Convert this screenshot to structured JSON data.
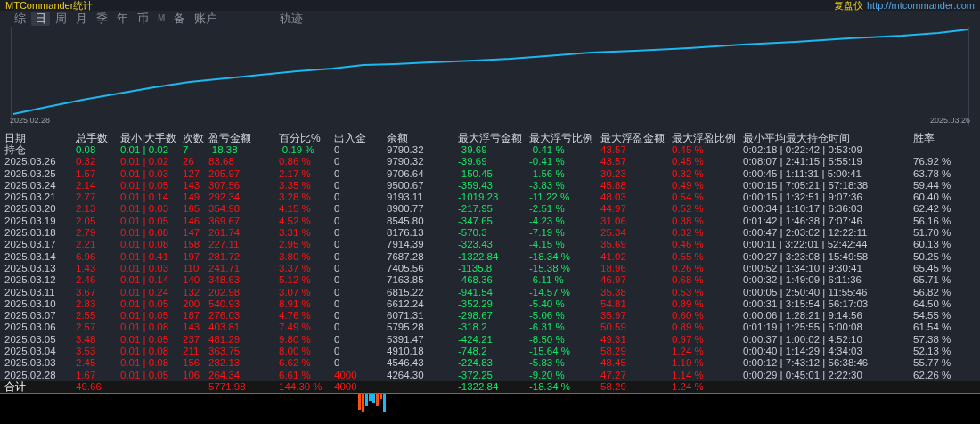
{
  "header": {
    "title": "MTCommander统计",
    "right_label": "复盘仪",
    "url": "http://mtcommander.com"
  },
  "tabs": [
    {
      "label": "综",
      "selected": false,
      "disabled": false
    },
    {
      "label": "日",
      "selected": true,
      "disabled": false
    },
    {
      "label": "周",
      "selected": false,
      "disabled": false
    },
    {
      "label": "月",
      "selected": false,
      "disabled": false
    },
    {
      "label": "季",
      "selected": false,
      "disabled": false
    },
    {
      "label": "年",
      "selected": false,
      "disabled": false
    },
    {
      "label": "币",
      "selected": false,
      "disabled": false
    },
    {
      "label": "M",
      "selected": false,
      "disabled": true
    },
    {
      "label": "备",
      "selected": false,
      "disabled": false
    },
    {
      "label": "账户",
      "selected": false,
      "disabled": false
    }
  ],
  "trace_tab": {
    "label": "轨迹",
    "selected": false
  },
  "equity_chart": {
    "start_label": "2025.02.28",
    "end_label": "2025.03.26"
  },
  "table": {
    "columns": [
      "日期",
      "总手数",
      "最小|大手数",
      "次数",
      "盈亏金额",
      "百分比%",
      "出入金",
      "余额",
      "最大浮亏金额",
      "最大浮亏比例",
      "最大浮盈金额",
      "最大浮盈比例",
      "最小平均最大持仓时间",
      "胜率"
    ],
    "rows": [
      {
        "kind": "open",
        "date": "持仓",
        "lots": "0.08",
        "lot_range": "0.01 | 0.02",
        "trades": "7",
        "pnl": "-18.38",
        "pct": "-0.19 %",
        "deposit": "0",
        "deposit_highlighted": false,
        "balance": "9790.32",
        "max_loss": "-39.69",
        "max_loss_pct": "-0.41 %",
        "max_profit": "43.57",
        "max_profit_pct": "0.45 %",
        "hold_time": "0:02:18 | 0:22:42 | 0:53:09"
      },
      {
        "kind": "day",
        "date": "2025.03.26",
        "lots": "0.32",
        "lot_range": "0.01 | 0.02",
        "trades": "26",
        "pnl": "83.68",
        "pct": "0.86 %",
        "deposit": "0",
        "deposit_highlighted": false,
        "balance": "9790.32",
        "max_loss": "-39.69",
        "max_loss_pct": "-0.41 %",
        "max_profit": "43.57",
        "max_profit_pct": "0.45 %",
        "hold_time": "0:08:07 | 2:41:15 | 5:55:19",
        "win_rate": "76.92 %"
      },
      {
        "kind": "day",
        "date": "2025.03.25",
        "lots": "1.57",
        "lot_range": "0.01 | 0.03",
        "trades": "127",
        "pnl": "205.97",
        "pct": "2.17 %",
        "deposit": "0",
        "deposit_highlighted": false,
        "balance": "9706.64",
        "max_loss": "-150.45",
        "max_loss_pct": "-1.56 %",
        "max_profit": "30.23",
        "max_profit_pct": "0.32 %",
        "hold_time": "0:00:45 | 1:11:31 | 5:00:41",
        "win_rate": "63.78 %"
      },
      {
        "kind": "day",
        "date": "2025.03.24",
        "lots": "2.14",
        "lot_range": "0.01 | 0.05",
        "trades": "143",
        "pnl": "307.56",
        "pct": "3.35 %",
        "deposit": "0",
        "deposit_highlighted": false,
        "balance": "9500.67",
        "max_loss": "-359.43",
        "max_loss_pct": "-3.83 %",
        "max_profit": "45.88",
        "max_profit_pct": "0.49 %",
        "hold_time": "0:00:15 | 7:05:21 | 57:18:38",
        "win_rate": "59.44 %"
      },
      {
        "kind": "day",
        "date": "2025.03.21",
        "lots": "2.77",
        "lot_range": "0.01 | 0.14",
        "trades": "149",
        "pnl": "292.34",
        "pct": "3.28 %",
        "deposit": "0",
        "deposit_highlighted": false,
        "balance": "9193.11",
        "max_loss": "-1019.23",
        "max_loss_pct": "-11.22 %",
        "max_profit": "48.03",
        "max_profit_pct": "0.54 %",
        "hold_time": "0:00:15 | 1:32:51 | 9:07:36",
        "win_rate": "60.40 %"
      },
      {
        "kind": "day",
        "date": "2025.03.20",
        "lots": "2.13",
        "lot_range": "0.01 | 0.03",
        "trades": "165",
        "pnl": "354.98",
        "pct": "4.15 %",
        "deposit": "0",
        "deposit_highlighted": false,
        "balance": "8900.77",
        "max_loss": "-217.95",
        "max_loss_pct": "-2.51 %",
        "max_profit": "44.97",
        "max_profit_pct": "0.52 %",
        "hold_time": "0:00:34 | 1:10:17 | 6:36:03",
        "win_rate": "62.42 %"
      },
      {
        "kind": "day",
        "date": "2025.03.19",
        "lots": "2.05",
        "lot_range": "0.01 | 0.05",
        "trades": "146",
        "pnl": "369.67",
        "pct": "4.52 %",
        "deposit": "0",
        "deposit_highlighted": false,
        "balance": "8545.80",
        "max_loss": "-347.65",
        "max_loss_pct": "-4.23 %",
        "max_profit": "31.06",
        "max_profit_pct": "0.38 %",
        "hold_time": "0:01:42 | 1:46:38 | 7:07:46",
        "win_rate": "56.16 %"
      },
      {
        "kind": "day",
        "date": "2025.03.18",
        "lots": "2.79",
        "lot_range": "0.01 | 0.08",
        "trades": "147",
        "pnl": "261.74",
        "pct": "3.31 %",
        "deposit": "0",
        "deposit_highlighted": false,
        "balance": "8176.13",
        "max_loss": "-570.3",
        "max_loss_pct": "-7.19 %",
        "max_profit": "25.34",
        "max_profit_pct": "0.32 %",
        "hold_time": "0:00:47 | 2:03:02 | 12:22:11",
        "win_rate": "51.70 %"
      },
      {
        "kind": "day",
        "date": "2025.03.17",
        "lots": "2.21",
        "lot_range": "0.01 | 0.08",
        "trades": "158",
        "pnl": "227.11",
        "pct": "2.95 %",
        "deposit": "0",
        "deposit_highlighted": false,
        "balance": "7914.39",
        "max_loss": "-323.43",
        "max_loss_pct": "-4.15 %",
        "max_profit": "35.69",
        "max_profit_pct": "0.46 %",
        "hold_time": "0:00:11 | 3:22:01 | 52:42:44",
        "win_rate": "60.13 %"
      },
      {
        "kind": "day",
        "date": "2025.03.14",
        "lots": "6.96",
        "lot_range": "0.01 | 0.41",
        "trades": "197",
        "pnl": "281.72",
        "pct": "3.80 %",
        "deposit": "0",
        "deposit_highlighted": false,
        "balance": "7687.28",
        "max_loss": "-1322.84",
        "max_loss_pct": "-18.34 %",
        "max_profit": "41.02",
        "max_profit_pct": "0.55 %",
        "hold_time": "0:00:27 | 3:23:08 | 15:49:58",
        "win_rate": "50.25 %"
      },
      {
        "kind": "day",
        "date": "2025.03.13",
        "lots": "1.43",
        "lot_range": "0.01 | 0.03",
        "trades": "110",
        "pnl": "241.71",
        "pct": "3.37 %",
        "deposit": "0",
        "deposit_highlighted": false,
        "balance": "7405.56",
        "max_loss": "-1135.8",
        "max_loss_pct": "-15.38 %",
        "max_profit": "18.96",
        "max_profit_pct": "0.26 %",
        "hold_time": "0:00:52 | 1:34:10 | 9:30:41",
        "win_rate": "65.45 %"
      },
      {
        "kind": "day",
        "date": "2025.03.12",
        "lots": "2.46",
        "lot_range": "0.01 | 0.14",
        "trades": "140",
        "pnl": "348.63",
        "pct": "5.12 %",
        "deposit": "0",
        "deposit_highlighted": false,
        "balance": "7163.85",
        "max_loss": "-468.36",
        "max_loss_pct": "-6.11 %",
        "max_profit": "46.97",
        "max_profit_pct": "0.68 %",
        "hold_time": "0:00:32 | 1:49:09 | 6:11:36",
        "win_rate": "65.71 %"
      },
      {
        "kind": "day",
        "date": "2025.03.11",
        "lots": "3.67",
        "lot_range": "0.01 | 0.24",
        "trades": "132",
        "pnl": "202.98",
        "pct": "3.07 %",
        "deposit": "0",
        "deposit_highlighted": false,
        "balance": "6815.22",
        "max_loss": "-941.54",
        "max_loss_pct": "-14.57 %",
        "max_profit": "35.38",
        "max_profit_pct": "0.53 %",
        "hold_time": "0:00:05 | 2:50:40 | 11:55:46",
        "win_rate": "56.82 %"
      },
      {
        "kind": "day",
        "date": "2025.03.10",
        "lots": "2.83",
        "lot_range": "0.01 | 0.05",
        "trades": "200",
        "pnl": "540.93",
        "pct": "8.91 %",
        "deposit": "0",
        "deposit_highlighted": false,
        "balance": "6612.24",
        "max_loss": "-352.29",
        "max_loss_pct": "-5.40 %",
        "max_profit": "54.81",
        "max_profit_pct": "0.89 %",
        "hold_time": "0:00:31 | 3:15:54 | 56:17:03",
        "win_rate": "64.50 %"
      },
      {
        "kind": "day",
        "date": "2025.03.07",
        "lots": "2.55",
        "lot_range": "0.01 | 0.05",
        "trades": "187",
        "pnl": "276.03",
        "pct": "4.76 %",
        "deposit": "0",
        "deposit_highlighted": false,
        "balance": "6071.31",
        "max_loss": "-298.67",
        "max_loss_pct": "-5.06 %",
        "max_profit": "35.97",
        "max_profit_pct": "0.60 %",
        "hold_time": "0:00:06 | 1:28:21 | 9:14:56",
        "win_rate": "54.55 %"
      },
      {
        "kind": "day",
        "date": "2025.03.06",
        "lots": "2.57",
        "lot_range": "0.01 | 0.08",
        "trades": "143",
        "pnl": "403.81",
        "pct": "7.49 %",
        "deposit": "0",
        "deposit_highlighted": false,
        "balance": "5795.28",
        "max_loss": "-318.2",
        "max_loss_pct": "-6.31 %",
        "max_profit": "50.59",
        "max_profit_pct": "0.89 %",
        "hold_time": "0:01:19 | 1:25:55 | 5:00:08",
        "win_rate": "61.54 %"
      },
      {
        "kind": "day",
        "date": "2025.03.05",
        "lots": "3.48",
        "lot_range": "0.01 | 0.05",
        "trades": "237",
        "pnl": "481.29",
        "pct": "9.80 %",
        "deposit": "0",
        "deposit_highlighted": false,
        "balance": "5391.47",
        "max_loss": "-424.21",
        "max_loss_pct": "-8.50 %",
        "max_profit": "49.31",
        "max_profit_pct": "0.97 %",
        "hold_time": "0:00:37 | 1:00:02 | 4:52:10",
        "win_rate": "57.38 %"
      },
      {
        "kind": "day",
        "date": "2025.03.04",
        "lots": "3.53",
        "lot_range": "0.01 | 0.08",
        "trades": "211",
        "pnl": "363.75",
        "pct": "8.00 %",
        "deposit": "0",
        "deposit_highlighted": false,
        "balance": "4910.18",
        "max_loss": "-748.2",
        "max_loss_pct": "-15.64 %",
        "max_profit": "58.29",
        "max_profit_pct": "1.24 %",
        "hold_time": "0:00:40 | 1:14:29 | 4:34:03",
        "win_rate": "52.13 %"
      },
      {
        "kind": "day",
        "date": "2025.03.03",
        "lots": "2.45",
        "lot_range": "0.01 | 0.08",
        "trades": "156",
        "pnl": "282.13",
        "pct": "6.62 %",
        "deposit": "0",
        "deposit_highlighted": false,
        "balance": "4546.43",
        "max_loss": "-224.83",
        "max_loss_pct": "-5.83 %",
        "max_profit": "48.45",
        "max_profit_pct": "1.10 %",
        "hold_time": "0:00:12 | 7:43:12 | 56:38:46",
        "win_rate": "55.77 %"
      },
      {
        "kind": "day",
        "date": "2025.02.28",
        "lots": "1.67",
        "lot_range": "0.01 | 0.05",
        "trades": "106",
        "pnl": "264.34",
        "pct": "6.61 %",
        "deposit": "4000",
        "deposit_highlighted": true,
        "balance": "4264.30",
        "max_loss": "-372.25",
        "max_loss_pct": "-9.20 %",
        "max_profit": "47.27",
        "max_profit_pct": "1.14 %",
        "hold_time": "0:00:29 | 0:45:01 | 2:22:30",
        "win_rate": "62.26 %"
      },
      {
        "kind": "total",
        "date": "合计",
        "lots": "49.66",
        "pnl": "5771.98",
        "pct": "144.30 %",
        "deposit": "4000",
        "deposit_highlighted": true,
        "max_loss": "-1322.84",
        "max_loss_pct": "-18.34 %",
        "max_profit": "58.29",
        "max_profit_pct": "1.24 %"
      }
    ]
  }
}
